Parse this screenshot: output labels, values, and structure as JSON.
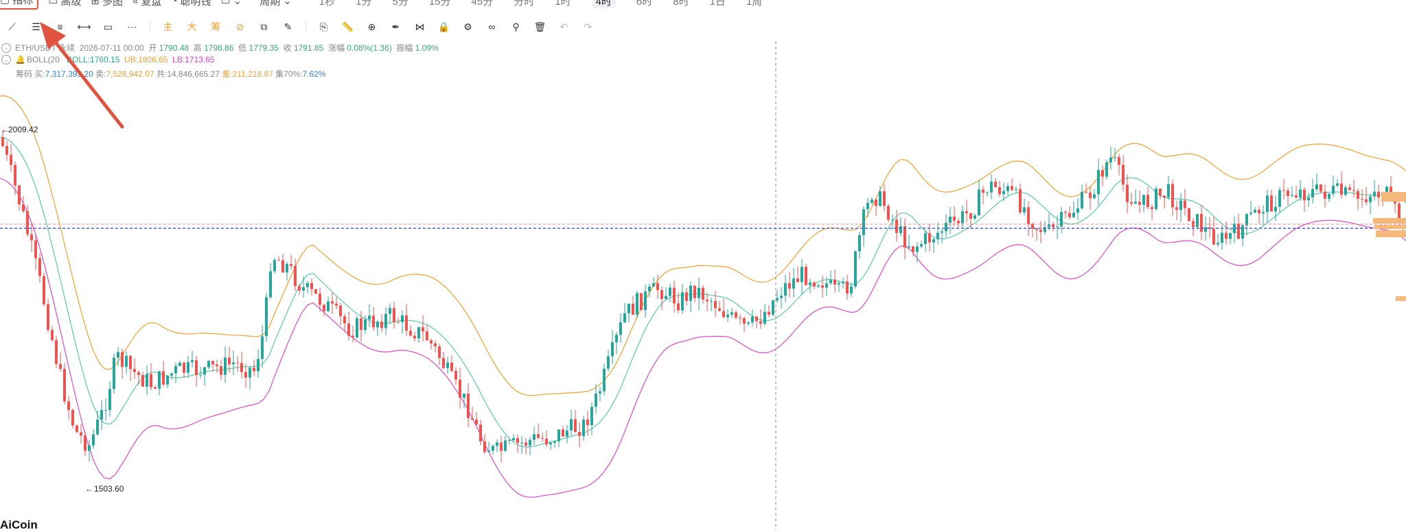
{
  "topbar": {
    "indicator": "指标",
    "advanced": "高级",
    "multi": "多图",
    "replay": "复盘",
    "smart": "聪明钱",
    "period_menu": "周期",
    "periods": [
      "1秒",
      "1分",
      "5分",
      "15分",
      "45分",
      "分时",
      "1时",
      "4时",
      "6时",
      "8时",
      "1日",
      "1周"
    ],
    "active_period": "4时"
  },
  "toolbar": {
    "main": "主",
    "big": "大",
    "chip": "筹"
  },
  "ohlc": {
    "symbol": "ETH/USDT 永续",
    "datetime": "2026-07-11 00:00",
    "open_label": "开",
    "open": "1790.48",
    "high_label": "高",
    "high": "1798.86",
    "low_label": "低",
    "low": "1779.35",
    "close_label": "收",
    "close": "1791.85",
    "change_label": "涨幅",
    "change": "0.08%(1.36)",
    "amp_label": "振幅",
    "amp": "1.09%"
  },
  "boll": {
    "name": "BOLL(20",
    "mid": "BOLL:1760.15",
    "ub": "UB:1806.65",
    "lb": "LB:1713.65"
  },
  "chips": {
    "label": "筹码",
    "buy_label": "买:",
    "buy": "7,317,393.20",
    "sell_label": "卖:",
    "sell": "7,528,942.07",
    "total_label": "共:",
    "total": "14,846,665.27",
    "diff_label": "差:",
    "diff": "211,218.87",
    "conc_label": "集70%:",
    "conc": "7.62%"
  },
  "price_high": "2009.42",
  "price_low": "1503.60",
  "logo": "AiCoin",
  "colors": {
    "up": "#26a69a",
    "down": "#ef5350",
    "ub": "#f0a030",
    "mid": "#5ac8a8",
    "lb": "#d84ac8",
    "accent": "#e2533f"
  }
}
